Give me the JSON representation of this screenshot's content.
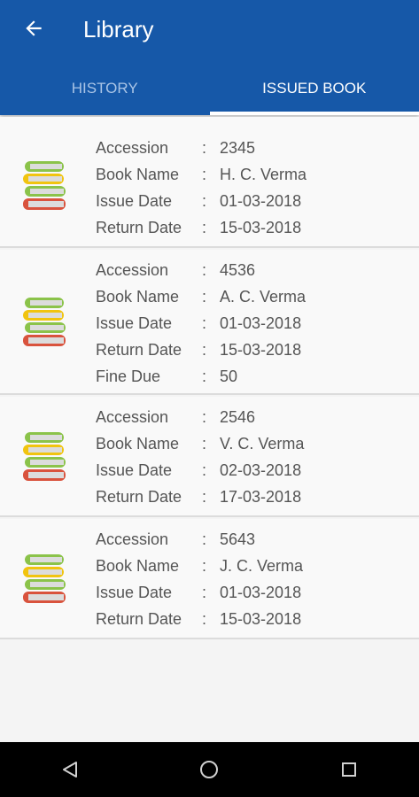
{
  "app": {
    "title": "Library",
    "colors": {
      "primary": "#1658a8",
      "tab_active": "#ffffff",
      "tab_inactive": "#a9c4e6"
    }
  },
  "tabs": [
    {
      "label": "HISTORY",
      "active": false
    },
    {
      "label": "ISSUED BOOK",
      "active": true
    }
  ],
  "fields": {
    "accession": "Accession",
    "book_name": "Book Name",
    "issue_date": "Issue Date",
    "return_date": "Return Date",
    "fine_due": "Fine Due",
    "separator": ":"
  },
  "books": [
    {
      "accession": "2345",
      "book_name": "H. C. Verma",
      "issue_date": "01-03-2018",
      "return_date": "15-03-2018"
    },
    {
      "accession": "4536",
      "book_name": "A. C. Verma",
      "issue_date": "01-03-2018",
      "return_date": "15-03-2018",
      "fine_due": "50"
    },
    {
      "accession": "2546",
      "book_name": "V. C. Verma",
      "issue_date": "02-03-2018",
      "return_date": "17-03-2018"
    },
    {
      "accession": "5643",
      "book_name": "J. C. Verma",
      "issue_date": "01-03-2018",
      "return_date": "15-03-2018"
    }
  ],
  "icons": {
    "back": "arrow-left-icon",
    "book": "book-stack-icon",
    "nav_back": "triangle-back-icon",
    "nav_home": "circle-home-icon",
    "nav_recents": "square-recents-icon"
  }
}
